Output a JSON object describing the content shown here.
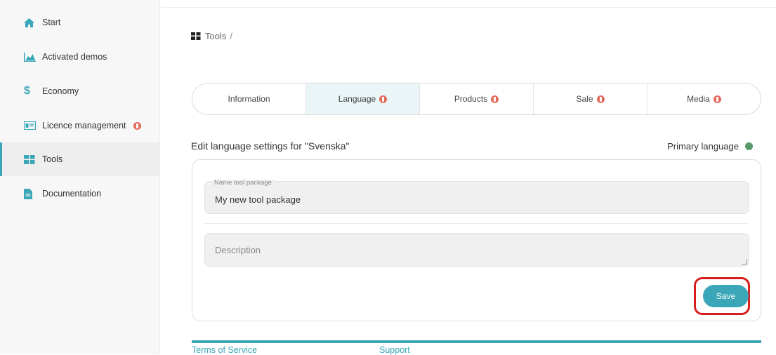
{
  "sidebar": {
    "items": [
      {
        "label": "Start",
        "icon": "home-icon"
      },
      {
        "label": "Activated demos",
        "icon": "area-chart-icon"
      },
      {
        "label": "Economy",
        "icon": "dollar-icon"
      },
      {
        "label": "Licence management",
        "icon": "id-card-icon"
      },
      {
        "label": "Tools",
        "icon": "grid-icon"
      },
      {
        "label": "Documentation",
        "icon": "document-icon"
      }
    ],
    "active": "Tools"
  },
  "breadcrumb": {
    "label": "Tools",
    "separator": "/"
  },
  "tabs": [
    {
      "label": "Information"
    },
    {
      "label": "Language"
    },
    {
      "label": "Products"
    },
    {
      "label": "Sale"
    },
    {
      "label": "Media"
    }
  ],
  "edit": {
    "title": "Edit language settings for \"Svenska\"",
    "primary_label": "Primary language"
  },
  "form": {
    "name_legend": "Name tool package",
    "name_value": "My new tool package",
    "description_placeholder": "Description",
    "save_label": "Save"
  },
  "footer": {
    "terms": "Terms of Service",
    "support": "Support"
  },
  "colors": {
    "accent": "#3aa6b7",
    "badge": "#e46a5b",
    "primary_dot": "#5a9a68",
    "highlight": "#d81d1d"
  }
}
